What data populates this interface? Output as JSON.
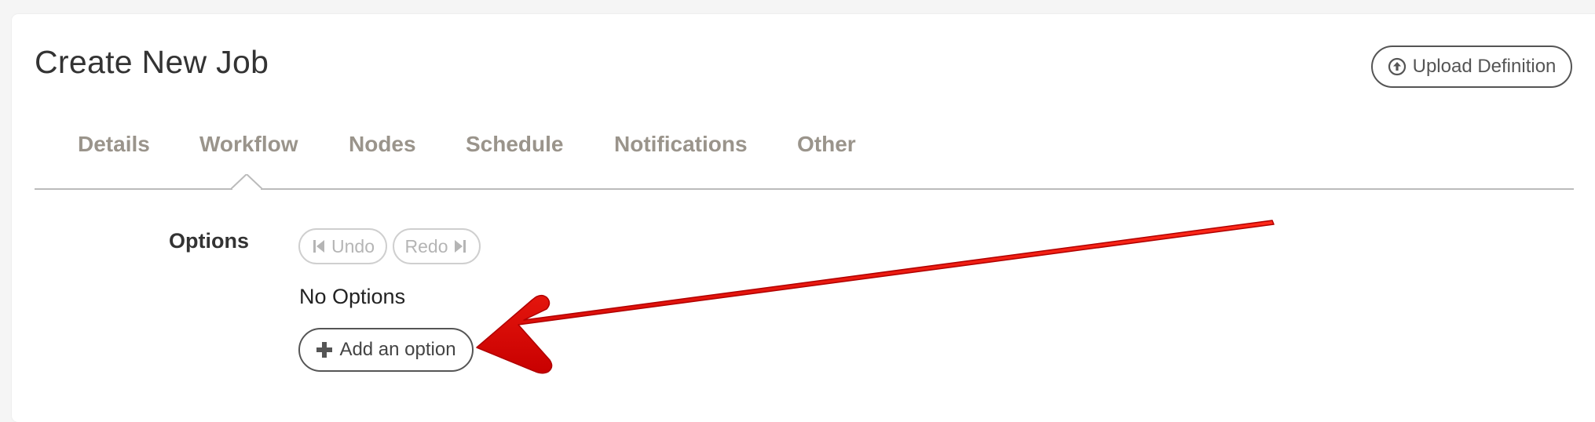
{
  "page": {
    "title": "Create New Job"
  },
  "header": {
    "upload_label": "Upload Definition"
  },
  "tabs": [
    {
      "label": "Details"
    },
    {
      "label": "Workflow"
    },
    {
      "label": "Nodes"
    },
    {
      "label": "Schedule"
    },
    {
      "label": "Notifications"
    },
    {
      "label": "Other"
    }
  ],
  "active_tab": "Workflow",
  "options": {
    "section_label": "Options",
    "undo_label": "Undo",
    "redo_label": "Redo",
    "empty_text": "No Options",
    "add_label": "Add an option"
  },
  "colors": {
    "tab_text": "#9a948b",
    "annotation_arrow": "#e00000",
    "button_border": "#555555",
    "disabled_text": "#b5b5b5"
  }
}
